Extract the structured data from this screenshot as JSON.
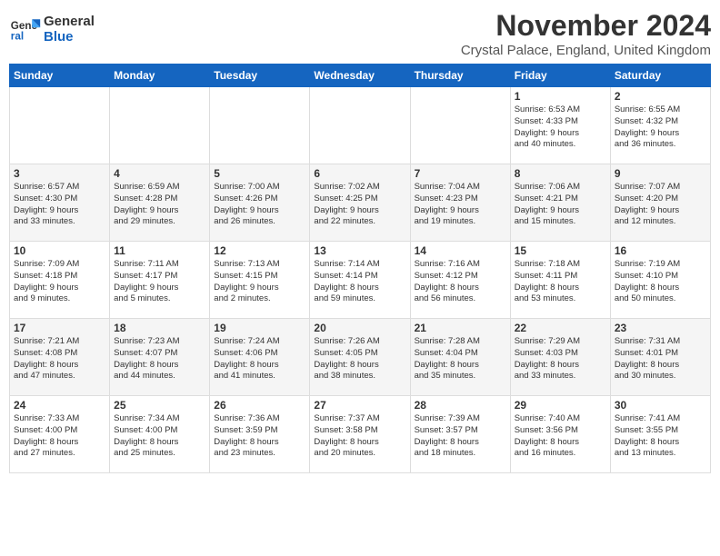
{
  "header": {
    "logo_line1": "General",
    "logo_line2": "Blue",
    "month": "November 2024",
    "location": "Crystal Palace, England, United Kingdom"
  },
  "weekdays": [
    "Sunday",
    "Monday",
    "Tuesday",
    "Wednesday",
    "Thursday",
    "Friday",
    "Saturday"
  ],
  "weeks": [
    [
      {
        "day": "",
        "info": ""
      },
      {
        "day": "",
        "info": ""
      },
      {
        "day": "",
        "info": ""
      },
      {
        "day": "",
        "info": ""
      },
      {
        "day": "",
        "info": ""
      },
      {
        "day": "1",
        "info": "Sunrise: 6:53 AM\nSunset: 4:33 PM\nDaylight: 9 hours\nand 40 minutes."
      },
      {
        "day": "2",
        "info": "Sunrise: 6:55 AM\nSunset: 4:32 PM\nDaylight: 9 hours\nand 36 minutes."
      }
    ],
    [
      {
        "day": "3",
        "info": "Sunrise: 6:57 AM\nSunset: 4:30 PM\nDaylight: 9 hours\nand 33 minutes."
      },
      {
        "day": "4",
        "info": "Sunrise: 6:59 AM\nSunset: 4:28 PM\nDaylight: 9 hours\nand 29 minutes."
      },
      {
        "day": "5",
        "info": "Sunrise: 7:00 AM\nSunset: 4:26 PM\nDaylight: 9 hours\nand 26 minutes."
      },
      {
        "day": "6",
        "info": "Sunrise: 7:02 AM\nSunset: 4:25 PM\nDaylight: 9 hours\nand 22 minutes."
      },
      {
        "day": "7",
        "info": "Sunrise: 7:04 AM\nSunset: 4:23 PM\nDaylight: 9 hours\nand 19 minutes."
      },
      {
        "day": "8",
        "info": "Sunrise: 7:06 AM\nSunset: 4:21 PM\nDaylight: 9 hours\nand 15 minutes."
      },
      {
        "day": "9",
        "info": "Sunrise: 7:07 AM\nSunset: 4:20 PM\nDaylight: 9 hours\nand 12 minutes."
      }
    ],
    [
      {
        "day": "10",
        "info": "Sunrise: 7:09 AM\nSunset: 4:18 PM\nDaylight: 9 hours\nand 9 minutes."
      },
      {
        "day": "11",
        "info": "Sunrise: 7:11 AM\nSunset: 4:17 PM\nDaylight: 9 hours\nand 5 minutes."
      },
      {
        "day": "12",
        "info": "Sunrise: 7:13 AM\nSunset: 4:15 PM\nDaylight: 9 hours\nand 2 minutes."
      },
      {
        "day": "13",
        "info": "Sunrise: 7:14 AM\nSunset: 4:14 PM\nDaylight: 8 hours\nand 59 minutes."
      },
      {
        "day": "14",
        "info": "Sunrise: 7:16 AM\nSunset: 4:12 PM\nDaylight: 8 hours\nand 56 minutes."
      },
      {
        "day": "15",
        "info": "Sunrise: 7:18 AM\nSunset: 4:11 PM\nDaylight: 8 hours\nand 53 minutes."
      },
      {
        "day": "16",
        "info": "Sunrise: 7:19 AM\nSunset: 4:10 PM\nDaylight: 8 hours\nand 50 minutes."
      }
    ],
    [
      {
        "day": "17",
        "info": "Sunrise: 7:21 AM\nSunset: 4:08 PM\nDaylight: 8 hours\nand 47 minutes."
      },
      {
        "day": "18",
        "info": "Sunrise: 7:23 AM\nSunset: 4:07 PM\nDaylight: 8 hours\nand 44 minutes."
      },
      {
        "day": "19",
        "info": "Sunrise: 7:24 AM\nSunset: 4:06 PM\nDaylight: 8 hours\nand 41 minutes."
      },
      {
        "day": "20",
        "info": "Sunrise: 7:26 AM\nSunset: 4:05 PM\nDaylight: 8 hours\nand 38 minutes."
      },
      {
        "day": "21",
        "info": "Sunrise: 7:28 AM\nSunset: 4:04 PM\nDaylight: 8 hours\nand 35 minutes."
      },
      {
        "day": "22",
        "info": "Sunrise: 7:29 AM\nSunset: 4:03 PM\nDaylight: 8 hours\nand 33 minutes."
      },
      {
        "day": "23",
        "info": "Sunrise: 7:31 AM\nSunset: 4:01 PM\nDaylight: 8 hours\nand 30 minutes."
      }
    ],
    [
      {
        "day": "24",
        "info": "Sunrise: 7:33 AM\nSunset: 4:00 PM\nDaylight: 8 hours\nand 27 minutes."
      },
      {
        "day": "25",
        "info": "Sunrise: 7:34 AM\nSunset: 4:00 PM\nDaylight: 8 hours\nand 25 minutes."
      },
      {
        "day": "26",
        "info": "Sunrise: 7:36 AM\nSunset: 3:59 PM\nDaylight: 8 hours\nand 23 minutes."
      },
      {
        "day": "27",
        "info": "Sunrise: 7:37 AM\nSunset: 3:58 PM\nDaylight: 8 hours\nand 20 minutes."
      },
      {
        "day": "28",
        "info": "Sunrise: 7:39 AM\nSunset: 3:57 PM\nDaylight: 8 hours\nand 18 minutes."
      },
      {
        "day": "29",
        "info": "Sunrise: 7:40 AM\nSunset: 3:56 PM\nDaylight: 8 hours\nand 16 minutes."
      },
      {
        "day": "30",
        "info": "Sunrise: 7:41 AM\nSunset: 3:55 PM\nDaylight: 8 hours\nand 13 minutes."
      }
    ]
  ]
}
